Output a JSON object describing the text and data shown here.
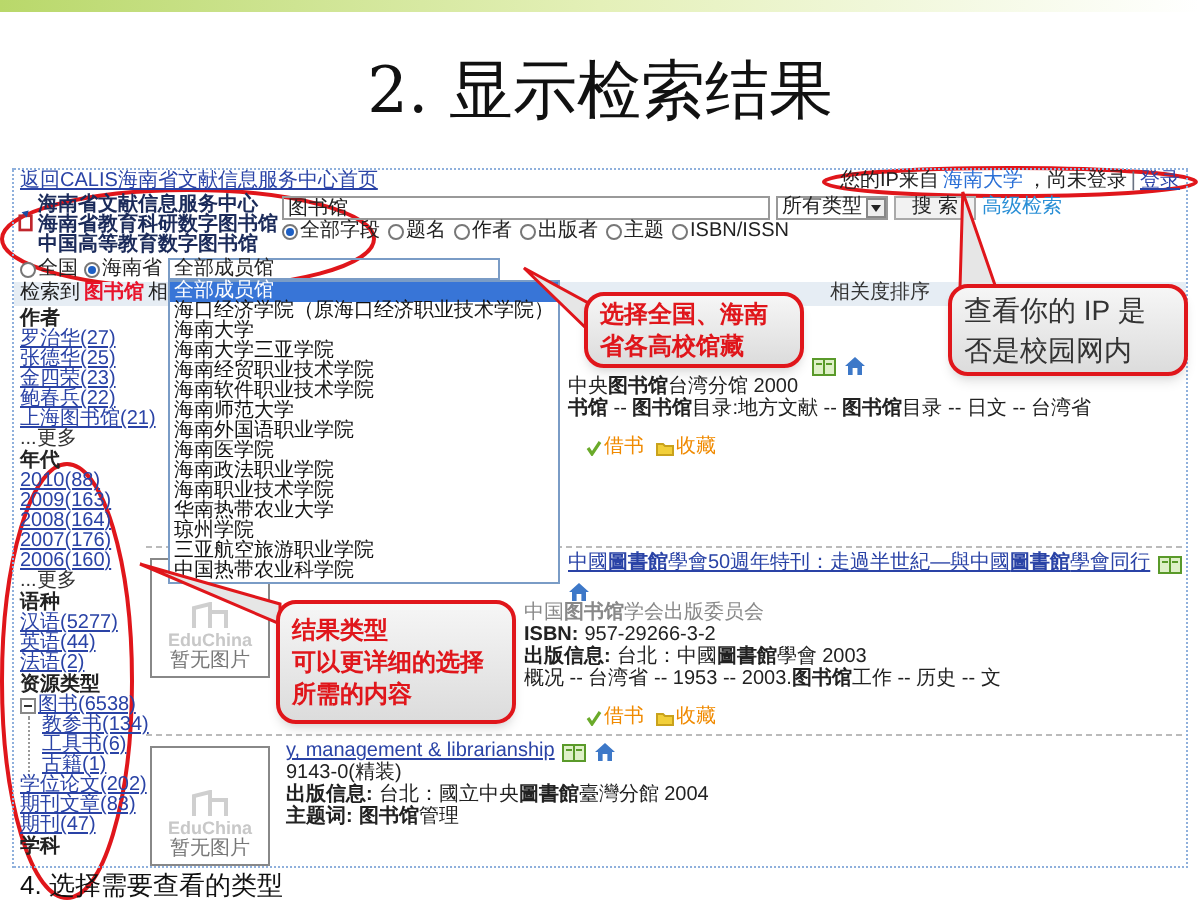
{
  "slide_title": "2. 显示检索结果",
  "page": {
    "home_link": "返回CALIS海南省文献信息服务中心首页",
    "user_status": {
      "prefix": "您的IP来自",
      "institution": "海南大学",
      "status": "，尚未登录",
      "separator": "|",
      "login": "登录"
    },
    "logo": {
      "lines": [
        "海南省文献信息服务中心",
        "海南省教育科研数字图书馆",
        "中国高等教育数字图书馆"
      ]
    },
    "search": {
      "value": "图书馆",
      "type": "所有类型",
      "button": "搜 索",
      "advanced": "高级检索"
    },
    "fields": [
      {
        "label": "全部字段",
        "selected": true
      },
      {
        "label": "题名",
        "selected": false
      },
      {
        "label": "作者",
        "selected": false
      },
      {
        "label": "出版者",
        "selected": false
      },
      {
        "label": "主题",
        "selected": false
      },
      {
        "label": "ISBN/ISSN",
        "selected": false
      }
    ],
    "scope": [
      {
        "label": "全国",
        "selected": false
      },
      {
        "label": "海南省",
        "selected": true
      }
    ],
    "member_select": {
      "value": "全部成员馆",
      "options": [
        {
          "label": "全部成员馆",
          "selected": true
        },
        {
          "label": "海口经济学院（原海口经济职业技术学院）",
          "selected": false
        },
        {
          "label": "海南大学",
          "selected": false
        },
        {
          "label": "海南大学三亚学院",
          "selected": false
        },
        {
          "label": "海南经贸职业技术学院",
          "selected": false
        },
        {
          "label": "海南软件职业技术学院",
          "selected": false
        },
        {
          "label": "海南师范大学",
          "selected": false
        },
        {
          "label": "海南外国语职业学院",
          "selected": false
        },
        {
          "label": "海南医学院",
          "selected": false
        },
        {
          "label": "海南政法职业学院",
          "selected": false
        },
        {
          "label": "海南职业技术学院",
          "selected": false
        },
        {
          "label": "华南热带农业大学",
          "selected": false
        },
        {
          "label": "琼州学院",
          "selected": false
        },
        {
          "label": "三亚航空旅游职业学院",
          "selected": false
        },
        {
          "label": "中国热带农业科学院",
          "selected": false
        }
      ]
    },
    "summary": {
      "before": "检索到",
      "term": "图书馆",
      "after": "相"
    },
    "sort_label": "相关度排序",
    "facets": [
      {
        "title": "作者",
        "items": [
          {
            "label": "罗治华(27)",
            "kind": "link"
          },
          {
            "label": "张德华(25)",
            "kind": "link"
          },
          {
            "label": "金四荣(23)",
            "kind": "link"
          },
          {
            "label": "鲍春兵(22)",
            "kind": "link"
          },
          {
            "label": "上海图书馆(21)",
            "kind": "link"
          },
          {
            "label": "...更多",
            "kind": "more"
          }
        ]
      },
      {
        "title": "年代",
        "items": [
          {
            "label": "2010(88)",
            "kind": "link"
          },
          {
            "label": "2009(163)",
            "kind": "link"
          },
          {
            "label": "2008(164)",
            "kind": "link"
          },
          {
            "label": "2007(176)",
            "kind": "link"
          },
          {
            "label": "2006(160)",
            "kind": "link"
          },
          {
            "label": "...更多",
            "kind": "more"
          }
        ]
      },
      {
        "title": "语种",
        "items": [
          {
            "label": "汉语(5277)",
            "kind": "link"
          },
          {
            "label": "英语(44)",
            "kind": "link"
          },
          {
            "label": "法语(2)",
            "kind": "link"
          }
        ]
      },
      {
        "title": "资源类型",
        "items": [
          {
            "label": "图书(6538)",
            "kind": "link",
            "expanded": true,
            "children": [
              {
                "label": "教参书(134)"
              },
              {
                "label": "工具书(6)"
              },
              {
                "label": "古籍(1)"
              }
            ]
          },
          {
            "label": "学位论文(202)",
            "kind": "link"
          },
          {
            "label": "期刊文章(83)",
            "kind": "link"
          },
          {
            "label": "期刊(47)",
            "kind": "link"
          }
        ]
      },
      {
        "title": "学科"
      }
    ],
    "results": [
      {
        "lines": [
          {
            "text": "中央**图书馆**台湾分馆 2000"
          },
          {
            "text": "**书馆** -- **图书馆**目录:地方文献 -- **图书馆**目录 -- 日文 -- 台湾省"
          }
        ],
        "actions": [
          "借书",
          "收藏"
        ]
      },
      {
        "title": "中國**圖書館**學會50週年特刊：走過半世紀—與中國**圖書館**學會同行",
        "thumbnail": {
          "logo": "EduChina",
          "caption": "暂无图片"
        },
        "lines": [
          {
            "text": "中国**图书馆**学会出版委员会",
            "kind": "muted"
          },
          {
            "label": "ISBN:",
            "text": "957-29266-3-2"
          },
          {
            "label": "出版信息:",
            "text": "台北：中國**圖書館**學會 2003"
          },
          {
            "text": "概况 -- 台湾省 -- 1953 -- 2003.**图书馆**工作 -- 历史 -- 文"
          }
        ],
        "actions": [
          "借书",
          "收藏"
        ]
      },
      {
        "title": "y, management & librarianship",
        "thumbnail": {
          "logo": "EduChina",
          "caption": "暂无图片"
        },
        "lines": [
          {
            "text": "9143-0(精装)"
          },
          {
            "label": "出版信息:",
            "text": "台北：國立中央**圖書館**臺灣分館 2004"
          },
          {
            "label": "主题词:",
            "text": "**图书馆**管理"
          }
        ]
      }
    ]
  },
  "callouts": [
    {
      "lines": [
        "选择全国、海南",
        "省各高校馆藏"
      ],
      "color": "#e0161b"
    },
    {
      "lines": [
        "查看你的 IP 是",
        "否是校园网内"
      ],
      "color": "#333333"
    },
    {
      "lines": [
        "结果类型",
        "可以更详细的选择",
        "所需的内容"
      ],
      "color": "#e0161b"
    }
  ],
  "footer_text": "4. 选择需要查看的类型"
}
